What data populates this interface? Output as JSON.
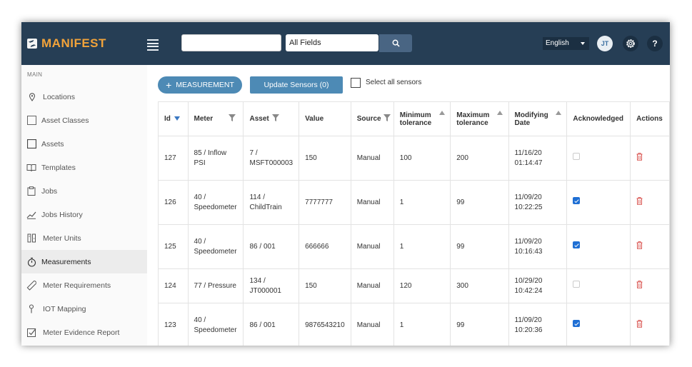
{
  "app": {
    "brand": "MANIFEST",
    "brand_color": "#f2a33a",
    "topbar_color": "#263e55",
    "accent": "#4d8ab5"
  },
  "header": {
    "search_placeholder": "",
    "search_scope": "All Fields",
    "language": "English",
    "user_initials": "JT",
    "help_label": "?"
  },
  "sidebar": {
    "section": "MAIN",
    "items": [
      {
        "label": "Locations",
        "icon": "location-pin-icon"
      },
      {
        "label": "Asset Classes",
        "icon": "square-icon"
      },
      {
        "label": "Assets",
        "icon": "square-icon"
      },
      {
        "label": "Templates",
        "icon": "book-icon"
      },
      {
        "label": "Jobs",
        "icon": "clipboard-icon"
      },
      {
        "label": "Jobs History",
        "icon": "trend-chart-icon"
      },
      {
        "label": "Meter Units",
        "icon": "meter-units-icon"
      },
      {
        "label": "Measurements",
        "icon": "stopwatch-icon",
        "active": true
      },
      {
        "label": "Meter Requirements",
        "icon": "ruler-icon"
      },
      {
        "label": "IOT Mapping",
        "icon": "map-pin-icon"
      },
      {
        "label": "Meter Evidence Report",
        "icon": "checkbox-report-icon"
      }
    ]
  },
  "toolbar": {
    "add_label": "MEASUREMENT",
    "update_label": "Update Sensors (0)",
    "select_all_label": "Select all sensors"
  },
  "table": {
    "headers": {
      "id": "Id",
      "meter": "Meter",
      "asset": "Asset",
      "value": "Value",
      "source": "Source",
      "min_tol": "Minimum tolerance",
      "max_tol": "Maximum tolerance",
      "mod_date": "Modifying Date",
      "ack": "Acknowledged",
      "actions": "Actions"
    },
    "rows": [
      {
        "id": "127",
        "meter": "85 / Inflow PSI",
        "asset": "7 / MSFT000003",
        "value": "150",
        "source": "Manual",
        "min": "100",
        "max": "200",
        "date": "11/16/20 01:14:47",
        "ack": false
      },
      {
        "id": "126",
        "meter": "40 / Speedometer",
        "asset": "114 / ChildTrain",
        "value": "7777777",
        "source": "Manual",
        "min": "1",
        "max": "99",
        "date": "11/09/20 10:22:25",
        "ack": true
      },
      {
        "id": "125",
        "meter": "40 / Speedometer",
        "asset": "86 / 001",
        "value": "666666",
        "source": "Manual",
        "min": "1",
        "max": "99",
        "date": "11/09/20 10:16:43",
        "ack": true
      },
      {
        "id": "124",
        "meter": "77 / Pressure",
        "asset": "134 / JT000001",
        "value": "150",
        "source": "Manual",
        "min": "120",
        "max": "300",
        "date": "10/29/20 10:42:24",
        "ack": false
      },
      {
        "id": "123",
        "meter": "40 / Speedometer",
        "asset": "86 / 001",
        "value": "9876543210",
        "source": "Manual",
        "min": "1",
        "max": "99",
        "date": "11/09/20 10:20:36",
        "ack": true
      }
    ]
  }
}
